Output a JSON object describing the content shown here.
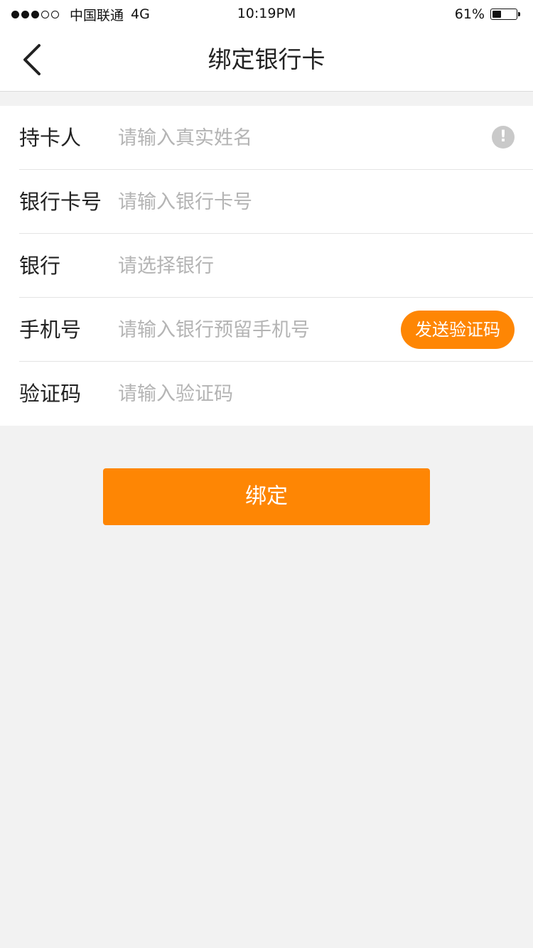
{
  "status_bar": {
    "carrier": "中国联通",
    "network": "4G",
    "time": "10:19PM",
    "battery": "61%",
    "battery_level": 0.61,
    "signal_strength": 3,
    "signal_max": 5
  },
  "nav": {
    "title": "绑定银行卡",
    "back_icon": "chevron-left-icon"
  },
  "form": {
    "cardholder": {
      "label": "持卡人",
      "placeholder": "请输入真实姓名",
      "value": "",
      "info_icon": "!"
    },
    "card_number": {
      "label": "银行卡号",
      "placeholder": "请输入银行卡号",
      "value": ""
    },
    "bank": {
      "label": "银行",
      "placeholder": "请选择银行",
      "value": ""
    },
    "phone": {
      "label": "手机号",
      "placeholder": "请输入银行预留手机号",
      "value": "",
      "send_code_label": "发送验证码"
    },
    "verify_code": {
      "label": "验证码",
      "placeholder": "请输入验证码",
      "value": ""
    }
  },
  "submit": {
    "label": "绑定"
  },
  "colors": {
    "accent": "#fe8604",
    "background": "#f2f2f2",
    "placeholder": "#b4b4b4",
    "info_icon": "#c9c9c9"
  }
}
